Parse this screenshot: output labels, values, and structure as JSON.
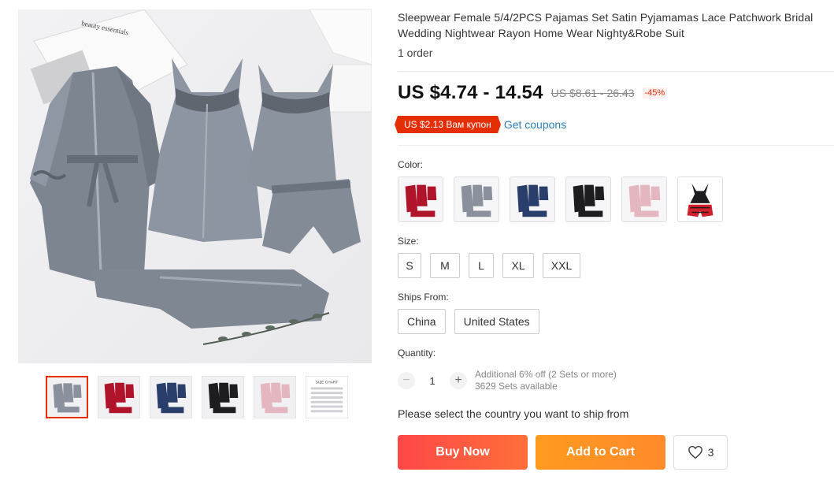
{
  "product": {
    "title": "Sleepwear Female 5/4/2PCS Pajamas Set Satin Pyjamamas Lace Patchwork Bridal Wedding Nightwear Rayon Home Wear Nighty&Robe Suit",
    "orders": "1 order"
  },
  "gallery": {
    "photo_text": "beauty essentials",
    "thumbnails": [
      {
        "name": "grey",
        "color": "#8a919c"
      },
      {
        "name": "red",
        "color": "#b0142a"
      },
      {
        "name": "navy",
        "color": "#2a3e6b"
      },
      {
        "name": "black",
        "color": "#1d1d1f"
      },
      {
        "name": "pink",
        "color": "#e4b6c0"
      },
      {
        "name": "size-chart",
        "label": "SIZE CHART"
      }
    ]
  },
  "price": {
    "current": "US $4.74 - 14.54",
    "original": "US $8.61 - 26.43",
    "discount": "-45%"
  },
  "coupon": {
    "tag": "US $2.13 Вам купон",
    "link": "Get coupons"
  },
  "color": {
    "label": "Color:",
    "swatches": [
      {
        "name": "red",
        "color": "#b0142a"
      },
      {
        "name": "grey",
        "color": "#8a919c"
      },
      {
        "name": "navy",
        "color": "#2a3e6b"
      },
      {
        "name": "black",
        "color": "#1d1d1f"
      },
      {
        "name": "pink",
        "color": "#e4b6c0"
      },
      {
        "name": "black-red",
        "color": "#1d1d1f",
        "accent": "#d21f2b"
      }
    ]
  },
  "size": {
    "label": "Size:",
    "options": [
      "S",
      "M",
      "L",
      "XL",
      "XXL"
    ]
  },
  "ships_from": {
    "label": "Ships From:",
    "options": [
      "China",
      "United States"
    ]
  },
  "quantity": {
    "label": "Quantity:",
    "value": "1",
    "minus": "−",
    "plus": "+",
    "promo": "Additional 6% off (2 Sets or more)",
    "available": "3629 Sets available"
  },
  "ship_message": "Please select the country you want to ship from",
  "actions": {
    "buy_now": "Buy Now",
    "add_to_cart": "Add to Cart",
    "wishlist_count": "3"
  },
  "colors": {
    "accent_red": "#e62e04",
    "link_blue": "#2e7fb8",
    "buy_gradient": "#ff4747",
    "cart_gradient": "#ff9a1f"
  }
}
